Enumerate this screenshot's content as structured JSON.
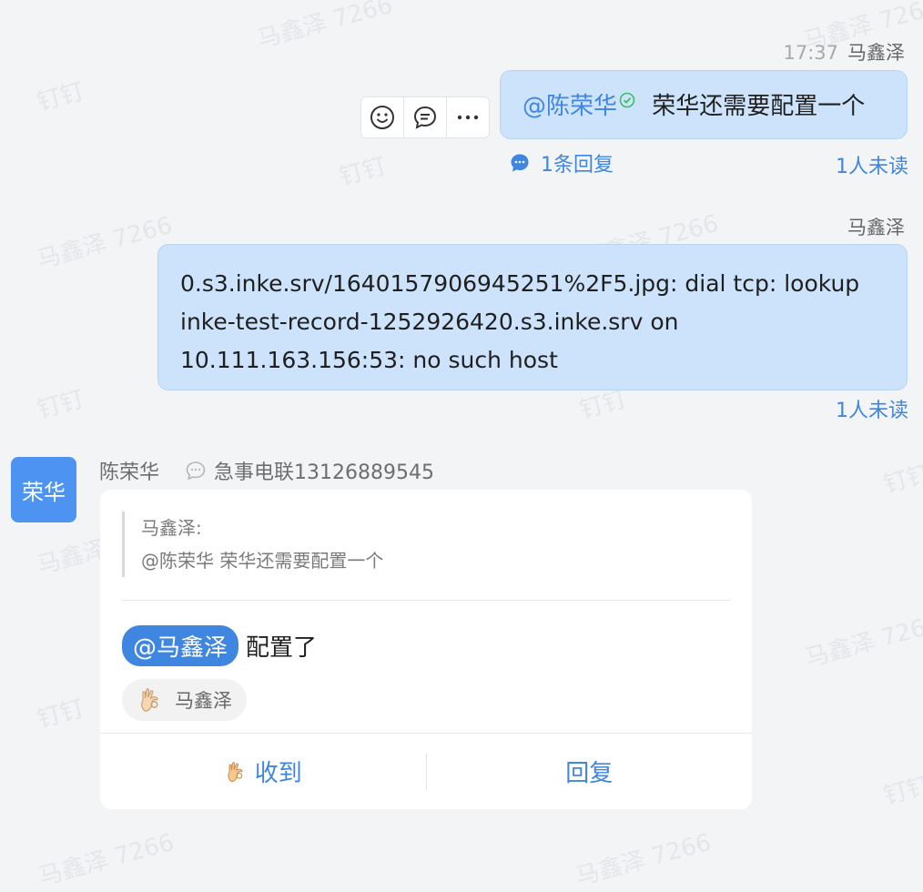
{
  "watermarks": [
    {
      "text": "马鑫泽 7266"
    },
    {
      "text": "马鑫泽 7266"
    },
    {
      "text": "钉钉"
    },
    {
      "text": "钉钉"
    },
    {
      "text": "马鑫泽 7266"
    },
    {
      "text": "马鑫泽 7266"
    },
    {
      "text": "钉钉"
    },
    {
      "text": "钉钉"
    },
    {
      "text": "马鑫泽 7266"
    },
    {
      "text": "马鑫泽 7266"
    },
    {
      "text": "钉钉"
    },
    {
      "text": "钉钉"
    },
    {
      "text": "马鑫泽 7266"
    },
    {
      "text": "马鑫泽 7266"
    },
    {
      "text": "钉钉"
    }
  ],
  "msg1": {
    "time": "17:37",
    "sender": "马鑫泽",
    "mention": "@陈荣华",
    "text": "荣华还需要配置一个",
    "reply_count": "1条回复",
    "unread": "1人未读"
  },
  "msg2": {
    "sender": "马鑫泽",
    "lines": [
      "0.s3.inke.srv/1640157906945251%2F5.jpg: dial tcp: lookup",
      "inke-test-record-1252926420.s3.inke.srv on",
      "10.111.163.156:53: no such host"
    ],
    "unread": "1人未读"
  },
  "msg3": {
    "avatar_text": "荣华",
    "sender": "陈荣华",
    "ding_label": "急事电联13126889545",
    "quote_author": "马鑫泽:",
    "quote_text": "@陈荣华  荣华还需要配置一个",
    "mention": "@马鑫泽",
    "text": "配置了",
    "reaction_user": "马鑫泽",
    "action_receive": "收到",
    "action_reply": "回复"
  },
  "colors": {
    "accent": "#3f86e0",
    "bubble": "#cce3fb",
    "avatar": "#4c93f2"
  }
}
